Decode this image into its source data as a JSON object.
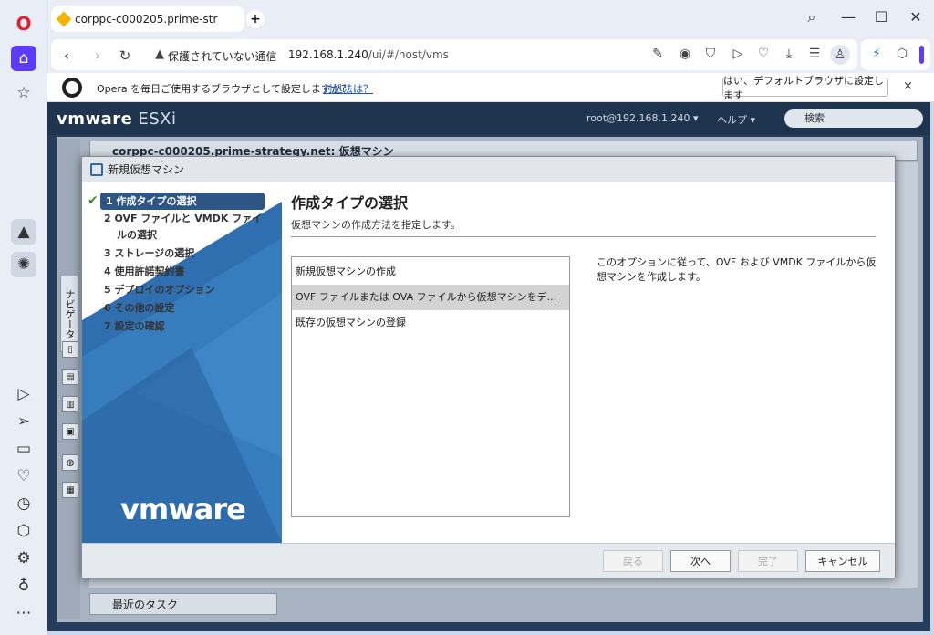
{
  "browser": {
    "tab_title": "corppc-c000205.prime-str",
    "security_warning": "保護されていない通信",
    "url_host": "192.168.1.240",
    "url_path": "/ui/#/host/vms"
  },
  "infobar": {
    "message": "Opera を毎日ご使用するブラウザとして設定しますか?",
    "link": "対処法は？",
    "button": "はい、デフォルトブラウザに設定します",
    "close": "×"
  },
  "esxi": {
    "brand": "vmware",
    "product": "ESXi",
    "user": "root@192.168.1.240 ▾",
    "help": "ヘルプ ▾",
    "search_placeholder": "検索",
    "navigator_tab": "ナビゲータ",
    "vm_title": "corppc-c000205.prime-strategy.net: 仮想マシン",
    "recent_tasks": "最近のタスク"
  },
  "wizard": {
    "title": "新規仮想マシン",
    "steps": [
      "1 作成タイプの選択",
      "2 OVF ファイルと VMDK ファイ",
      "ルの選択",
      "3 ストレージの選択",
      "4 使用許諾契約書",
      "5 デプロイのオプション",
      "6 その他の設定",
      "7 設定の確認"
    ],
    "logo": "vmware",
    "heading": "作成タイプの選択",
    "subheading": "仮想マシンの作成方法を指定します。",
    "options": [
      "新規仮想マシンの作成",
      "OVF ファイルまたは OVA ファイルから仮想マシンをデ...",
      "既存の仮想マシンの登録"
    ],
    "description": "このオプションに従って、OVF および VMDK ファイルから仮想マシンを作成します。",
    "buttons": {
      "back": "戻る",
      "next": "次へ",
      "finish": "完了",
      "cancel": "キャンセル"
    }
  }
}
